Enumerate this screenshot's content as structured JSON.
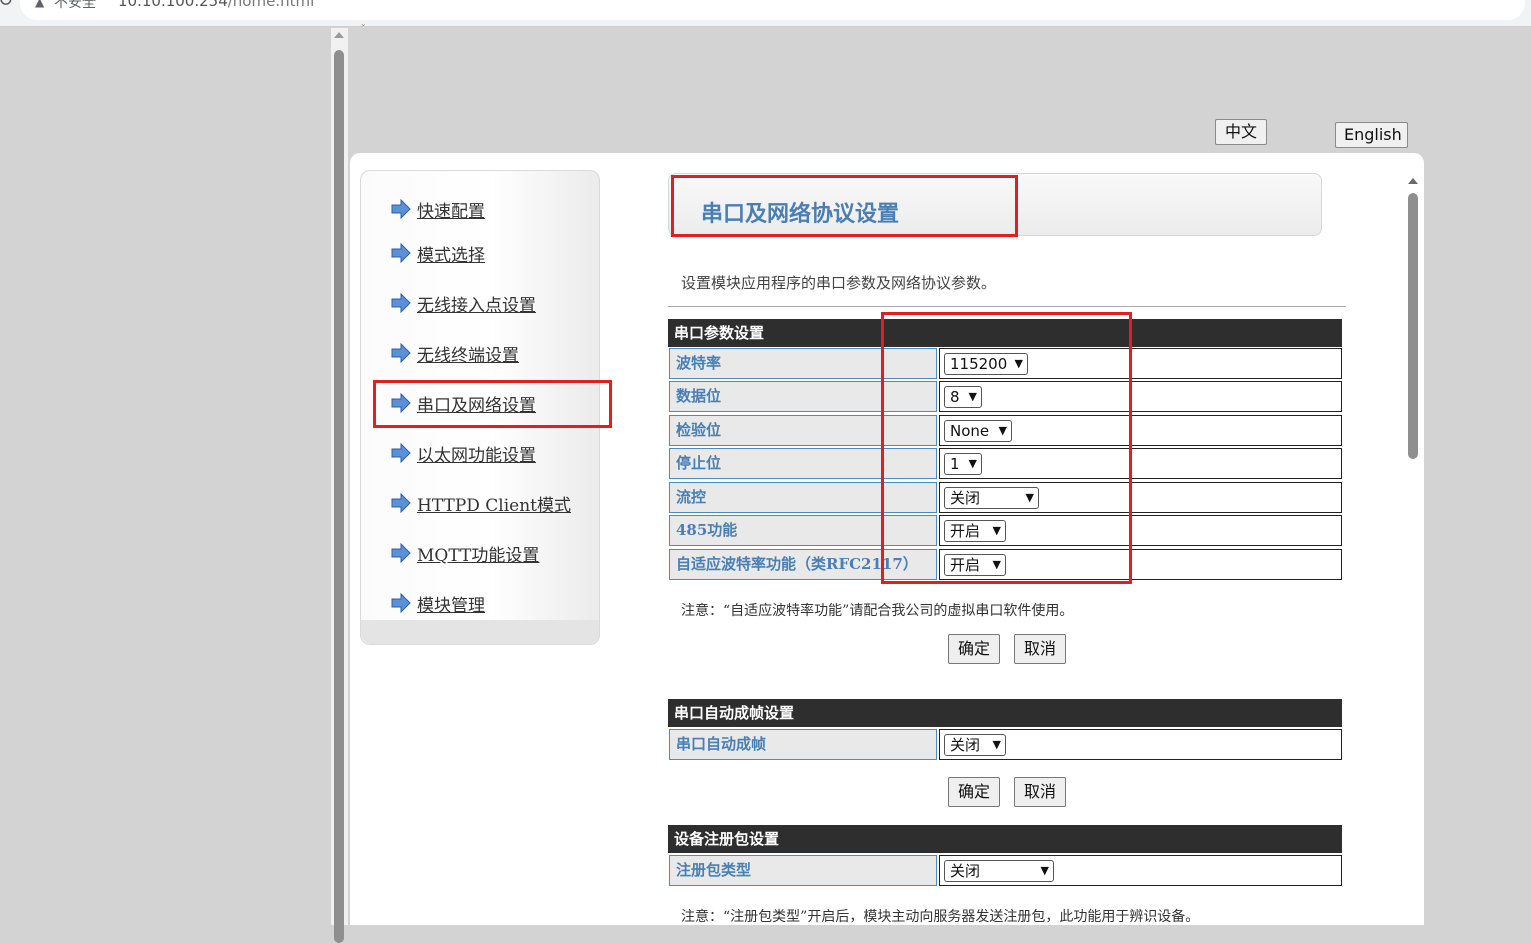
{
  "browser": {
    "insecure_label": "不安全",
    "url_host": "10.10.100.254",
    "url_path": "/home.html"
  },
  "lang": {
    "zh": "中文",
    "en": "English"
  },
  "menu": {
    "items": [
      {
        "label": "快速配置"
      },
      {
        "label": "模式选择"
      },
      {
        "label": "无线接入点设置"
      },
      {
        "label": "无线终端设置"
      },
      {
        "label": "串口及网络设置"
      },
      {
        "label": "以太网功能设置"
      },
      {
        "label": "HTTPD Client模式"
      },
      {
        "label": "MQTT功能设置"
      },
      {
        "label": "模块管理"
      }
    ],
    "active_index": 4
  },
  "page": {
    "title": "串口及网络协议设置",
    "description": "设置模块应用程序的串口参数及网络协议参数。"
  },
  "serial": {
    "header": "串口参数设置",
    "rows": [
      {
        "label": "波特率",
        "value": "115200"
      },
      {
        "label": "数据位",
        "value": "8"
      },
      {
        "label": "检验位",
        "value": "None"
      },
      {
        "label": "停止位",
        "value": "1"
      },
      {
        "label": "流控",
        "value": "关闭"
      },
      {
        "label": "485功能",
        "value": "开启"
      },
      {
        "label": "自适应波特率功能（类RFC2117）",
        "value": "开启"
      }
    ],
    "note": "注意：“自适应波特率功能”请配合我公司的虚拟串口软件使用。",
    "ok": "确定",
    "cancel": "取消"
  },
  "autoframe": {
    "header": "串口自动成帧设置",
    "rows": [
      {
        "label": "串口自动成帧",
        "value": "关闭"
      }
    ],
    "ok": "确定",
    "cancel": "取消"
  },
  "register": {
    "header": "设备注册包设置",
    "rows": [
      {
        "label": "注册包类型",
        "value": "关闭"
      }
    ],
    "note": "注意：“注册包类型”开启后，模块主动向服务器发送注册包，此功能用于辨识设备。"
  },
  "colors": {
    "accent": "#4a7fb4",
    "header_bg": "#2e2e2e",
    "highlight": "#e02020"
  }
}
